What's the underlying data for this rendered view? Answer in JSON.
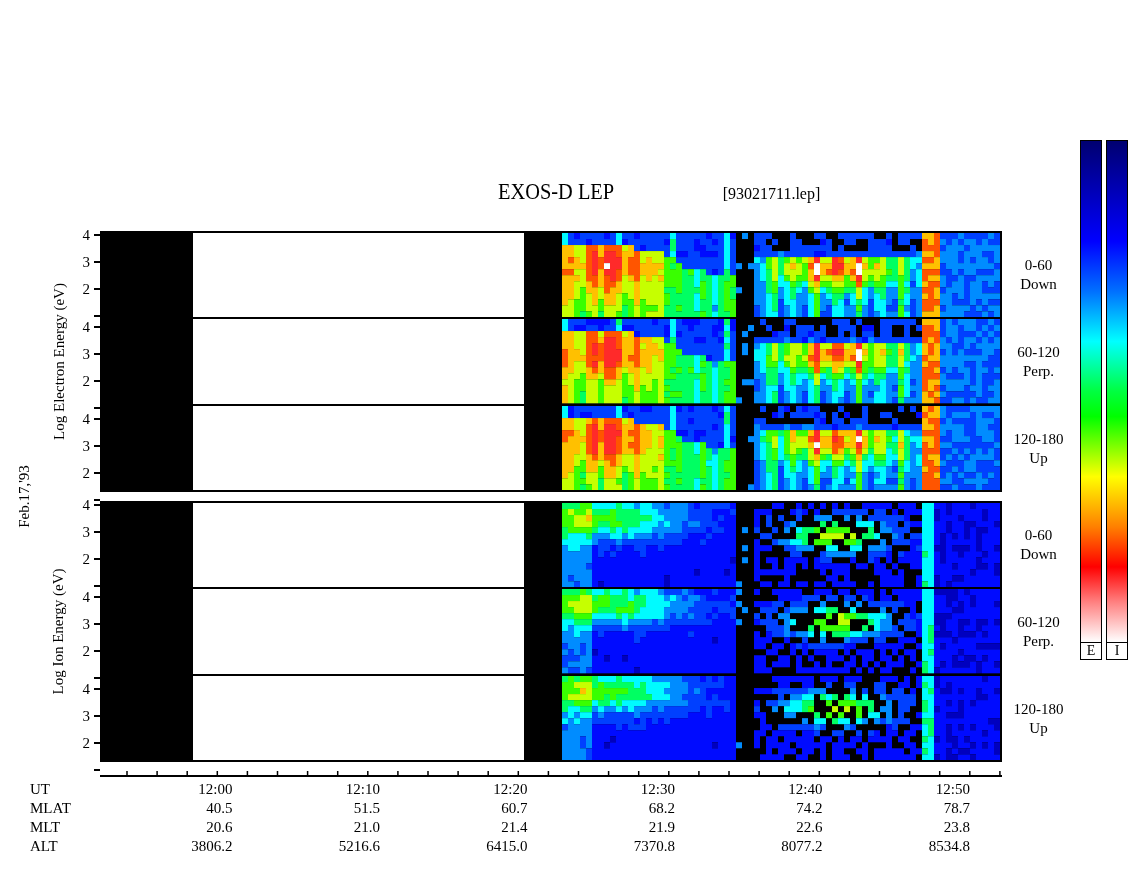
{
  "title": "EXOS-D LEP",
  "file": "[93021711.lep]",
  "date": "Feb.17,'93",
  "groups": [
    {
      "kind": "electron",
      "label": "Log  Electron  Energy (eV)",
      "panels": [
        {
          "angle": "0-60",
          "direction": "Down",
          "yticks": [
            "4",
            "3",
            "2"
          ]
        },
        {
          "angle": "60-120",
          "direction": "Perp.",
          "yticks": [
            "4",
            "3",
            "2"
          ]
        },
        {
          "angle": "120-180",
          "direction": "Up",
          "yticks": [
            "4",
            "3",
            "2"
          ]
        }
      ]
    },
    {
      "kind": "ion",
      "label": "Log  Ion  Energy (eV)",
      "panels": [
        {
          "angle": "0-60",
          "direction": "Down",
          "yticks": [
            "4",
            "3",
            "2"
          ]
        },
        {
          "angle": "60-120",
          "direction": "Perp.",
          "yticks": [
            "4",
            "3",
            "2"
          ]
        },
        {
          "angle": "120-180",
          "direction": "Up",
          "yticks": [
            "4",
            "3",
            "2"
          ]
        }
      ]
    }
  ],
  "axis_rows": [
    {
      "label": "UT",
      "values": [
        "12:00",
        "12:10",
        "12:20",
        "12:30",
        "12:40",
        "12:50"
      ]
    },
    {
      "label": "MLAT",
      "values": [
        "40.5",
        "51.5",
        "60.7",
        "68.2",
        "74.2",
        "78.7"
      ]
    },
    {
      "label": "MLT",
      "values": [
        "20.6",
        "21.0",
        "21.4",
        "21.9",
        "22.6",
        "23.8"
      ]
    },
    {
      "label": "ALT",
      "values": [
        "3806.2",
        "5216.6",
        "6415.0",
        "7370.8",
        "8077.2",
        "8534.8"
      ]
    }
  ],
  "color_scales": [
    {
      "label": "E"
    },
    {
      "label": "I"
    }
  ]
}
